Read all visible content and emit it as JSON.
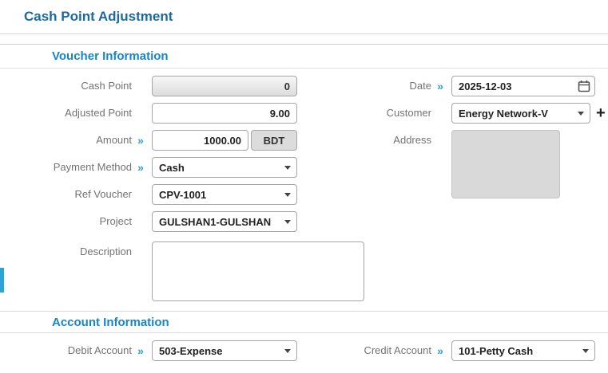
{
  "page": {
    "title": "Cash Point Adjustment"
  },
  "sections": {
    "voucher": "Voucher Information",
    "account": "Account Information"
  },
  "markers": {
    "required": "»",
    "plus": "+"
  },
  "fields": {
    "cash_point": {
      "label": "Cash Point",
      "value": "0"
    },
    "adjusted_point": {
      "label": "Adjusted Point",
      "value": "9.00"
    },
    "amount": {
      "label": "Amount",
      "value": "1000.00",
      "currency": "BDT"
    },
    "payment_method": {
      "label": "Payment Method",
      "value": "Cash"
    },
    "ref_voucher": {
      "label": "Ref Voucher",
      "value": "CPV-1001"
    },
    "project": {
      "label": "Project",
      "value": "GULSHAN1-GULSHAN"
    },
    "description": {
      "label": "Description",
      "value": ""
    },
    "date": {
      "label": "Date",
      "value": "2025-12-03"
    },
    "customer": {
      "label": "Customer",
      "value": "Energy Network-V"
    },
    "address": {
      "label": "Address",
      "value": ""
    },
    "debit_account": {
      "label": "Debit Account",
      "value": "503-Expense"
    },
    "credit_account": {
      "label": "Credit Account",
      "value": "101-Petty Cash"
    }
  },
  "colors": {
    "title": "#1a6a9f",
    "section_title": "#1586c8",
    "required_marker": "#2e9fd6",
    "accent_strip": "#2aa5d8"
  }
}
